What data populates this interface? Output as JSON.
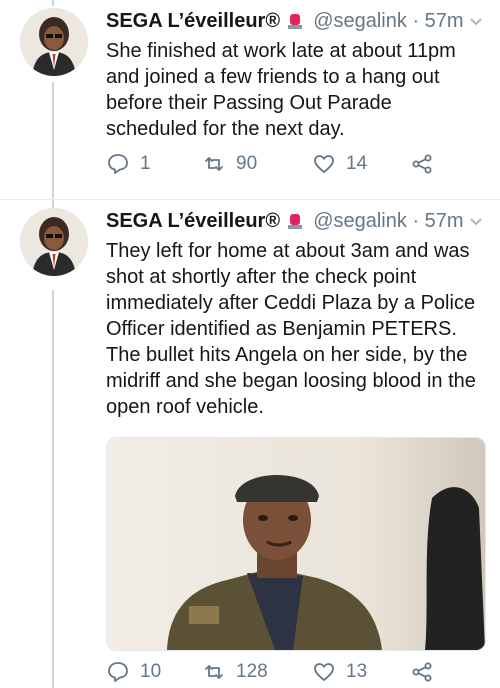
{
  "tweets": [
    {
      "display_name": "SEGA L’éveilleur®",
      "handle": "@segalink",
      "separator": "·",
      "time": "57m",
      "text_lines": [
        "She finished at work late at about 11pm",
        "and joined a few friends to a hang out",
        "before their Passing Out Parade",
        "scheduled for the next day."
      ],
      "replies": "1",
      "retweets": "90",
      "likes": "14"
    },
    {
      "display_name": "SEGA L’éveilleur®",
      "handle": "@segalink",
      "separator": "·",
      "time": "57m",
      "text_lines": [
        "They left for home at about 3am and was",
        "shot at shortly after the check point",
        "immediately after Ceddi Plaza by a Police",
        "Officer identified as Benjamin PETERS.",
        "The bullet hits Angela on her side, by the",
        "midriff and she began loosing blood in the",
        "open roof vehicle."
      ],
      "replies": "10",
      "retweets": "128",
      "likes": "13"
    }
  ],
  "icons": {
    "badge": "siren-badge-icon",
    "reply": "reply-icon",
    "retweet": "retweet-icon",
    "like": "heart-icon",
    "share": "share-icon",
    "menu": "chevron-down-icon"
  },
  "colors": {
    "text": "#14171a",
    "secondary": "#657786",
    "badge_red": "#e0245e",
    "thread_line": "#ccd6dd"
  }
}
